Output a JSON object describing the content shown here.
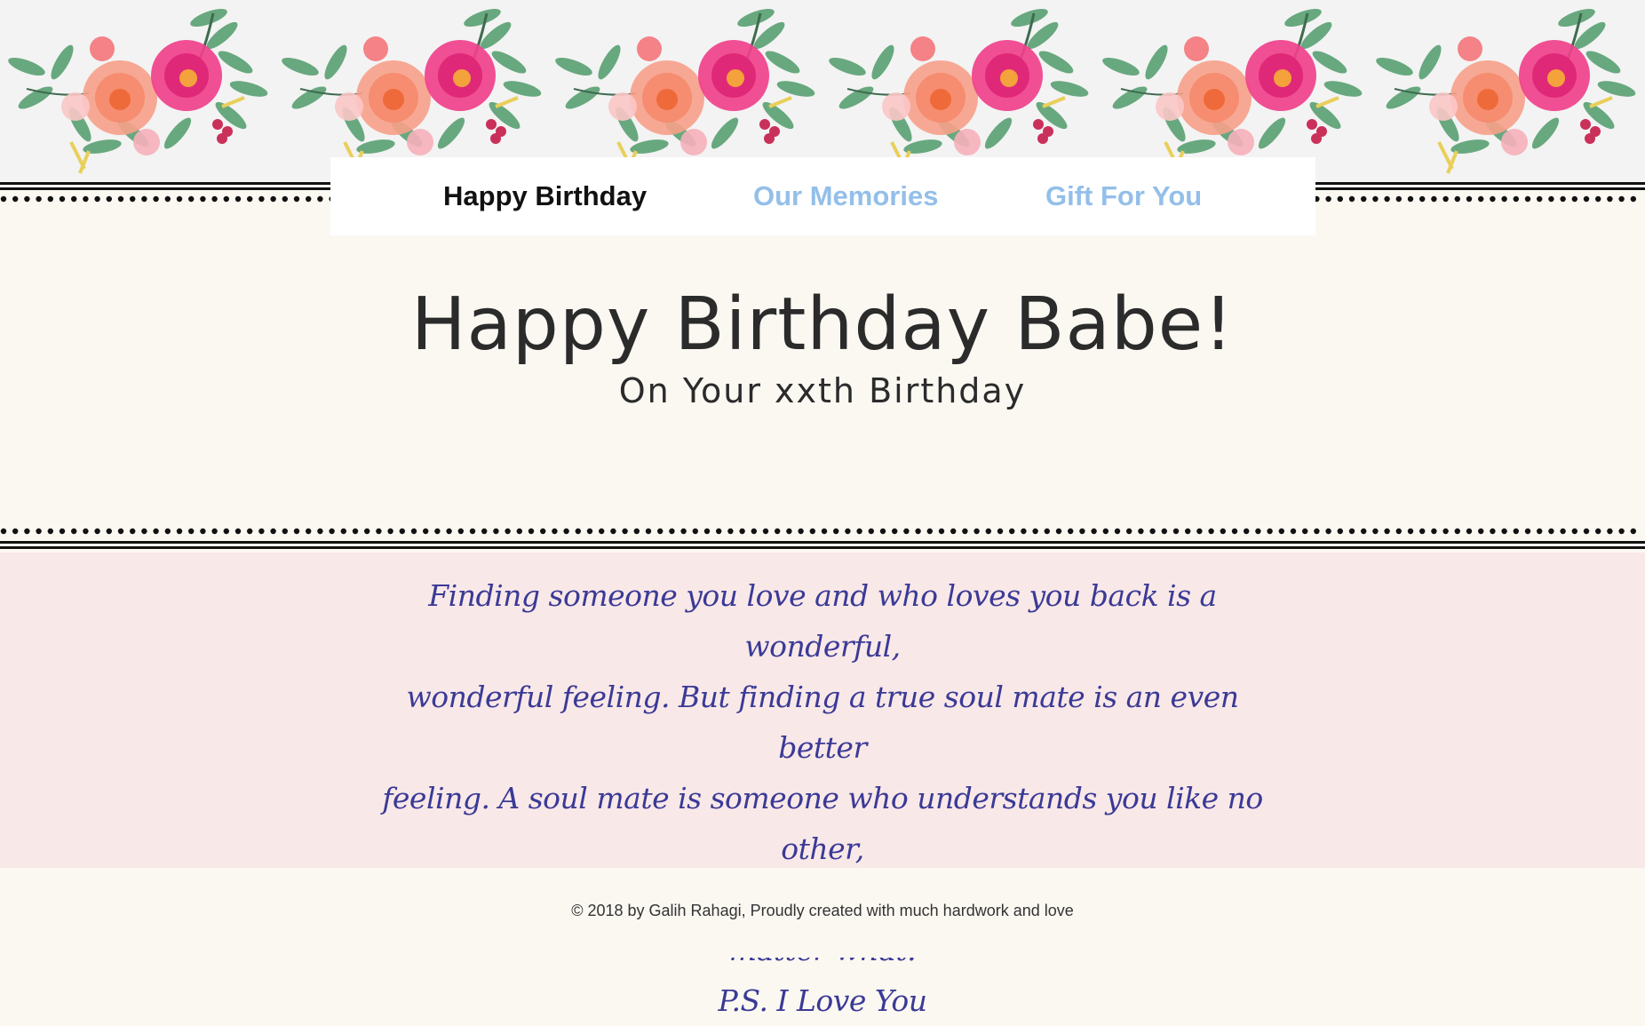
{
  "nav": {
    "items": [
      {
        "label": "Happy Birthday",
        "active": true
      },
      {
        "label": "Our Memories",
        "active": false
      },
      {
        "label": "Gift For You",
        "active": false
      }
    ]
  },
  "hero": {
    "title": "Happy Birthday Babe!",
    "subtitle": "On Your xxth Birthday"
  },
  "message": {
    "lines": [
      "Finding someone you love and who loves you back is a wonderful,",
      "wonderful feeling. But finding a true soul mate is an even better",
      "feeling. A soul mate is someone who understands you like no other,",
      "loves you like no other, will be there for you forever, no matter what.",
      "P.S. I Love You"
    ]
  },
  "footer": {
    "text": "© 2018 by Galih Rahagi, Proudly created with much hardwork and love"
  },
  "colors": {
    "page_bg": "#fbf8f2",
    "message_bg": "#f9e8e8",
    "message_text": "#3a3a96",
    "nav_active": "#111111",
    "nav_inactive": "#93bfe9",
    "flower_pink": "#f0418c",
    "flower_peach": "#f7a08a",
    "leaf_green": "#4f9a6a"
  },
  "icons": [
    "floral-bouquet-icon"
  ]
}
